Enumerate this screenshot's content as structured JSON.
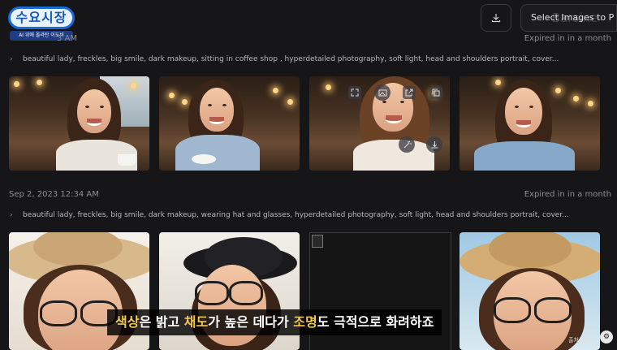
{
  "channel": {
    "logo_text": "수요시장",
    "logo_subtext": "AI 위에 올라탄 이도비"
  },
  "header": {
    "partial_date": "3 AM",
    "download_icon": "download-icon",
    "select_images_label": "Select Images to P",
    "select_ghost_text": "Barsine"
  },
  "groups": [
    {
      "date": "",
      "expired": "Expired in in a month",
      "prompt": "beautiful lady, freckles, big smile, dark makeup, sitting in coffee shop , hyperdetailed photography, soft light, head and shoulders portrait, cover..."
    },
    {
      "date": "Sep 2, 2023 12:34 AM",
      "expired": "Expired in in a month",
      "prompt": "beautiful lady, freckles, big smile, dark makeup, wearing hat and glasses, hyperdetailed photography, soft light, head and shoulders portrait, cover..."
    }
  ],
  "image_actions": [
    "expand-icon",
    "image-icon",
    "open-external-icon",
    "copy-icon",
    "wand-icon",
    "download-icon"
  ],
  "subtitle": {
    "part1": "색상",
    "part2": "은 밝고 ",
    "part3": "채도",
    "part4": "가 높은 데다가 ",
    "part5": "조명",
    "part6": "도 극적으로 화려하죠"
  },
  "credit": "출처: Planet A",
  "colors": {
    "background": "#161618",
    "highlight": "#f3c64a",
    "logo_blue": "#1b6bd6"
  }
}
